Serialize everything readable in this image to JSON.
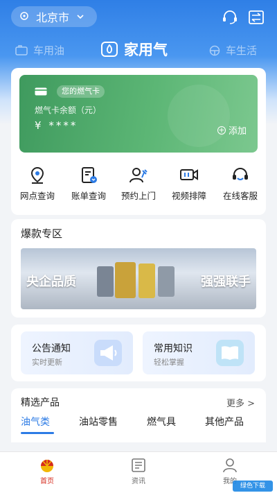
{
  "header": {
    "location": "北京市",
    "tabs": {
      "left": "车用油",
      "center": "家用气",
      "right": "车生活"
    }
  },
  "gas_card": {
    "tag": "您的燃气卡",
    "balance_label": "燃气卡余额（元）",
    "currency": "¥",
    "balance_masked": "****",
    "add_label": "添加"
  },
  "quick_actions": [
    {
      "label": "网点查询",
      "icon": "location-icon"
    },
    {
      "label": "账单查询",
      "icon": "bill-icon"
    },
    {
      "label": "预约上门",
      "icon": "appointment-icon"
    },
    {
      "label": "视频排障",
      "icon": "video-icon"
    },
    {
      "label": "在线客服",
      "icon": "headset-icon"
    }
  ],
  "hot_zone": {
    "title": "爆款专区",
    "banner_left": "央企品质",
    "banner_right": "强强联手"
  },
  "info_cards": [
    {
      "title": "公告通知",
      "subtitle": "实时更新",
      "icon": "megaphone-icon"
    },
    {
      "title": "常用知识",
      "subtitle": "轻松掌握",
      "icon": "book-icon"
    }
  ],
  "products": {
    "title": "精选产品",
    "more": "更多 >",
    "tabs": [
      "油气类",
      "油站零售",
      "燃气具",
      "其他产品"
    ],
    "active_tab": 0
  },
  "bottom_nav": [
    {
      "label": "首页",
      "icon": "home-logo-icon"
    },
    {
      "label": "资讯",
      "icon": "news-icon"
    },
    {
      "label": "我的",
      "icon": "profile-icon"
    }
  ],
  "colors": {
    "brand_blue": "#2c7be5",
    "card_green": "#5cb675",
    "active_red": "#d52b1e"
  },
  "watermark": "绿色下载"
}
